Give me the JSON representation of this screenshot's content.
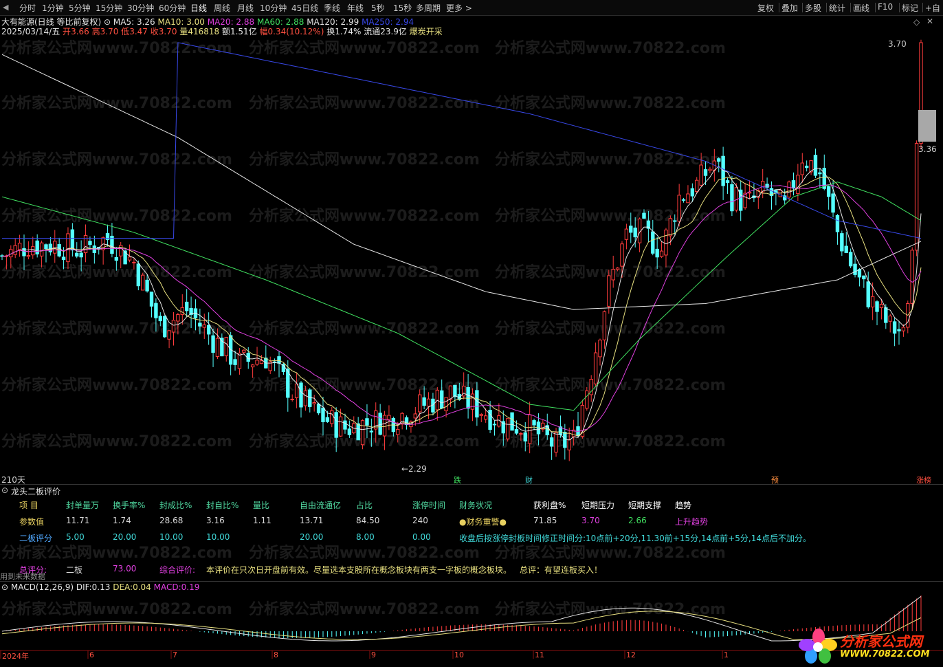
{
  "toolbar": {
    "periods": [
      "分时",
      "1分钟",
      "5分钟",
      "15分钟",
      "30分钟",
      "60分钟",
      "日线",
      "周线",
      "月线",
      "10分钟",
      "45日线",
      "季线",
      "年线",
      "5秒",
      "15秒",
      "多周期",
      "更多 >"
    ],
    "active": "日线",
    "right_tools": [
      "复权",
      "叠加",
      "多股",
      "统计",
      "画线",
      "F10",
      "标记",
      "+自"
    ]
  },
  "stock": {
    "name": "大有能源(日线 等比前复权)",
    "ma": [
      {
        "label": "MA5:",
        "value": "3.26",
        "color": "#e6e6e6"
      },
      {
        "label": "MA10:",
        "value": "3.00",
        "color": "#e8e080"
      },
      {
        "label": "MA20:",
        "value": "2.88",
        "color": "#e040e0"
      },
      {
        "label": "MA60:",
        "value": "2.88",
        "color": "#40e060"
      },
      {
        "label": "MA120:",
        "value": "2.99",
        "color": "#e6e6e6"
      },
      {
        "label": "MA250:",
        "value": "2.94",
        "color": "#3848e8"
      }
    ],
    "date": "2025/03/14/五",
    "open_label": "开",
    "open": "3.66",
    "high_label": "高",
    "high": "3.70",
    "low_label": "低",
    "low": "3.47",
    "close_label": "收",
    "close": "3.70",
    "vol_label": "量",
    "vol": "416818",
    "amount_label": "额",
    "amount": "1.51亿",
    "range_label": "幅",
    "range": "0.34(10.12%)",
    "turnover_label": "换",
    "turnover": "1.74%",
    "float_label": "流通",
    "float": "23.9亿",
    "concept": "爆炭开采"
  },
  "chart": {
    "high_mark": "3.70",
    "cur_price": "3.36",
    "low_mark": "←2.29",
    "days": "210天",
    "tags": [
      {
        "text": "跌",
        "color": "#40e060"
      },
      {
        "text": "财",
        "color": "#40d8d8"
      },
      {
        "text": "预",
        "color": "#ff9040"
      },
      {
        "text": "涨榜",
        "color": "#ff5040"
      }
    ]
  },
  "panel": {
    "title": "龙头二板评价",
    "headers": [
      "项 目",
      "封单量万",
      "换手率%",
      "封成比%",
      "封自比%",
      "量比",
      "自由流通亿",
      "占比",
      "涨停时间",
      "财务状况",
      "获利盘%",
      "短期压力",
      "短期支撑",
      "趋势"
    ],
    "row1_label": "参数值",
    "row1": [
      "11.71",
      "1.74",
      "28.68",
      "3.16",
      "1.11",
      "13.71",
      "84.50",
      "240"
    ],
    "finance": "●财务重警●",
    "profit": "71.85",
    "pressure": "3.70",
    "support": "2.66",
    "trend": "上升趋势",
    "row2_label": "二板评分",
    "row2": [
      "5.00",
      "20.00",
      "10.00",
      "10.00",
      "20.00",
      "8.00",
      "0.00"
    ],
    "note": "收盘后按涨停封板时间修正时间分:10点前+20分,11.30前+15分,14点前+5分,14点后不加分。",
    "total_label": "总评分:",
    "total_type": "二板",
    "total_score": "73.00",
    "comment_label": "综合评价:",
    "comment": "本评价在只次日开盘前有效。尽量选本支股所在概念板块有两支一字板的概念板块。",
    "summary": "总评：有望连板买入！",
    "future": "用到未来数据"
  },
  "macd": {
    "title": "MACD(12,26,9)",
    "dif_label": "DIF:",
    "dif": "0.13",
    "dea_label": "DEA:",
    "dea": "0.04",
    "macd_label": "MACD:",
    "macd": "0.19"
  },
  "xaxis": [
    "2024年",
    "6",
    "7",
    "8",
    "9",
    "10",
    "11",
    "12",
    "1"
  ],
  "watermark": "分析家公式网www.70822.com",
  "logo": {
    "name": "分析家公式网",
    "url": "WWW.70822.COM"
  },
  "colors": {
    "up": "#ff3c3c",
    "down": "#54ffff",
    "ma5": "#e6e6e6",
    "ma10": "#e8e080",
    "ma20": "#e040e0",
    "ma60": "#40e060",
    "ma120": "#e6e6e6",
    "ma250": "#3848e8"
  }
}
